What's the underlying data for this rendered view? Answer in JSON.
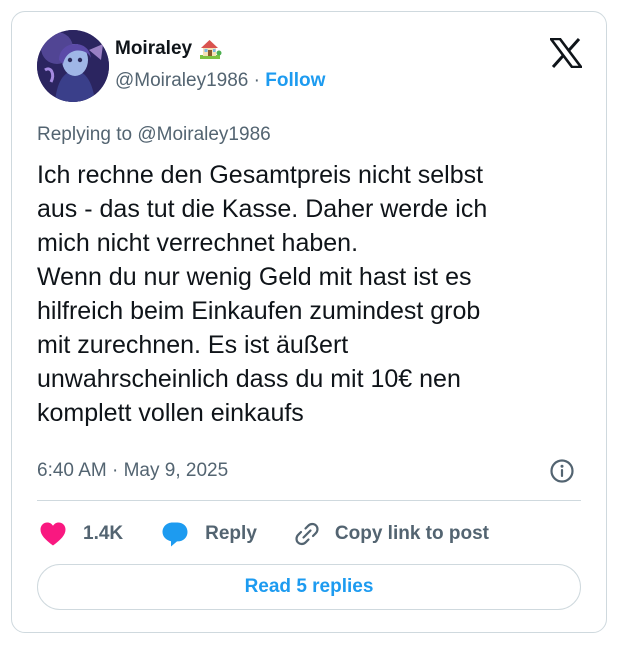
{
  "author": {
    "display_name": "Moiraley",
    "name_emoji": "house-with-garden-icon",
    "handle": "@Moiraley1986",
    "separator": "·",
    "follow_label": "Follow"
  },
  "replying_to": {
    "prefix": "Replying to ",
    "handle": "@Moiraley1986"
  },
  "tweet": {
    "lines": [
      "Ich rechne den Gesamtpreis nicht selbst",
      "aus - das tut die Kasse. Daher werde ich",
      "mich nicht verrechnet haben.",
      "Wenn du nur wenig Geld mit hast ist es",
      "hilfreich beim Einkaufen zumindest grob",
      "mit zurechnen. Es ist äußert",
      "unwahrscheinlich dass du mit 10€ nen",
      "komplett vollen einkaufs"
    ]
  },
  "meta": {
    "time": "6:40 AM",
    "separator": "·",
    "date": "May 9, 2025"
  },
  "actions": {
    "likes": "1.4K",
    "reply_label": "Reply",
    "copy_label": "Copy link to post"
  },
  "read_replies_label": "Read 5 replies",
  "colors": {
    "accent": "#1d9bf0",
    "like": "#f91880",
    "text": "#0f1419",
    "secondary": "#536471",
    "border": "#cfd9de"
  }
}
